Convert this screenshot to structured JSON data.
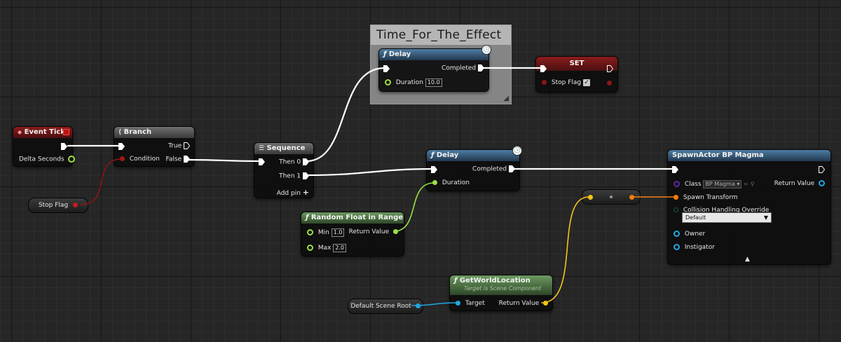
{
  "comment": {
    "title": "Time_For_The_Effect"
  },
  "nodes": {
    "event_tick": {
      "title": "Event Tick",
      "delta_seconds": "Delta Seconds"
    },
    "branch": {
      "title": "Branch",
      "true_label": "True",
      "false_label": "False",
      "condition_label": "Condition"
    },
    "stop_flag_get": {
      "label": "Stop Flag"
    },
    "sequence": {
      "title": "Sequence",
      "then0": "Then 0",
      "then1": "Then 1",
      "add_pin": "Add pin"
    },
    "delay_top": {
      "title": "Delay",
      "completed": "Completed",
      "duration_label": "Duration",
      "duration_value": "10.0"
    },
    "set_node": {
      "title": "SET",
      "stop_flag": "Stop Flag"
    },
    "delay_bottom": {
      "title": "Delay",
      "completed": "Completed",
      "duration_label": "Duration"
    },
    "random_float": {
      "title": "Random Float in Range",
      "min_label": "Min",
      "min_value": "1.0",
      "return_label": "Return Value",
      "max_label": "Max",
      "max_value": "2.0"
    },
    "get_world_location": {
      "title": "GetWorldLocation",
      "subtitle": "Target is Scene Component",
      "target_label": "Target",
      "return_label": "Return Value"
    },
    "default_scene_root": {
      "label": "Default Scene Root"
    },
    "spawn_actor": {
      "title": "SpawnActor BP Magma",
      "class_label": "Class",
      "class_value": "BP Magma",
      "return_label": "Return Value",
      "spawn_transform": "Spawn Transform",
      "collision_label": "Collision Handling Override",
      "collision_value": "Default",
      "owner_label": "Owner",
      "instigator_label": "Instigator"
    }
  },
  "colors": {
    "exec": "#ffffff",
    "bool": "#8c1515",
    "float": "#9ae046",
    "vector": "#f5c518",
    "transform": "#f07e0f",
    "object": "#1fa7e0",
    "class": "#5a2a9a"
  }
}
